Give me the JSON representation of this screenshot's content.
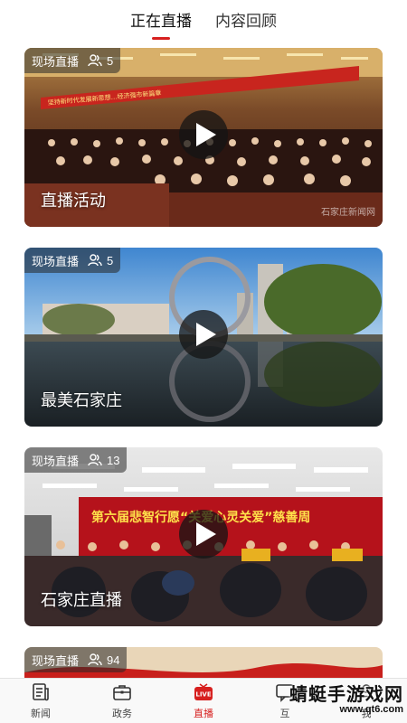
{
  "tabs": [
    {
      "label": "正在直播",
      "active": true
    },
    {
      "label": "内容回顾",
      "active": false
    }
  ],
  "cards": [
    {
      "badge": "现场直播",
      "viewers": "5",
      "title": "直播活动",
      "banner": "坚持新时代发展新思想…经济强市新篇章",
      "watermark": "石家庄新闻网"
    },
    {
      "badge": "现场直播",
      "viewers": "5",
      "title": "最美石家庄"
    },
    {
      "badge": "现场直播",
      "viewers": "13",
      "title": "石家庄直播",
      "banner": "第六届悲智行愿“关爱心灵关爱”慈善周"
    },
    {
      "badge": "现场直播",
      "viewers": "94",
      "title": ""
    }
  ],
  "nav": [
    {
      "label": "新闻",
      "icon": "newspaper-icon",
      "active": false
    },
    {
      "label": "政务",
      "icon": "briefcase-icon",
      "active": false
    },
    {
      "label": "直播",
      "icon": "live-tv-icon",
      "active": true
    },
    {
      "label": "互",
      "icon": "chat-icon",
      "active": false
    },
    {
      "label": "我",
      "icon": "user-icon",
      "active": false
    }
  ],
  "stamp": {
    "name": "蜻蜓手游戏网",
    "url": "www.qt6.com"
  },
  "colors": {
    "accent": "#d7201f",
    "badge_bg": "rgba(40,40,40,0.55)"
  }
}
